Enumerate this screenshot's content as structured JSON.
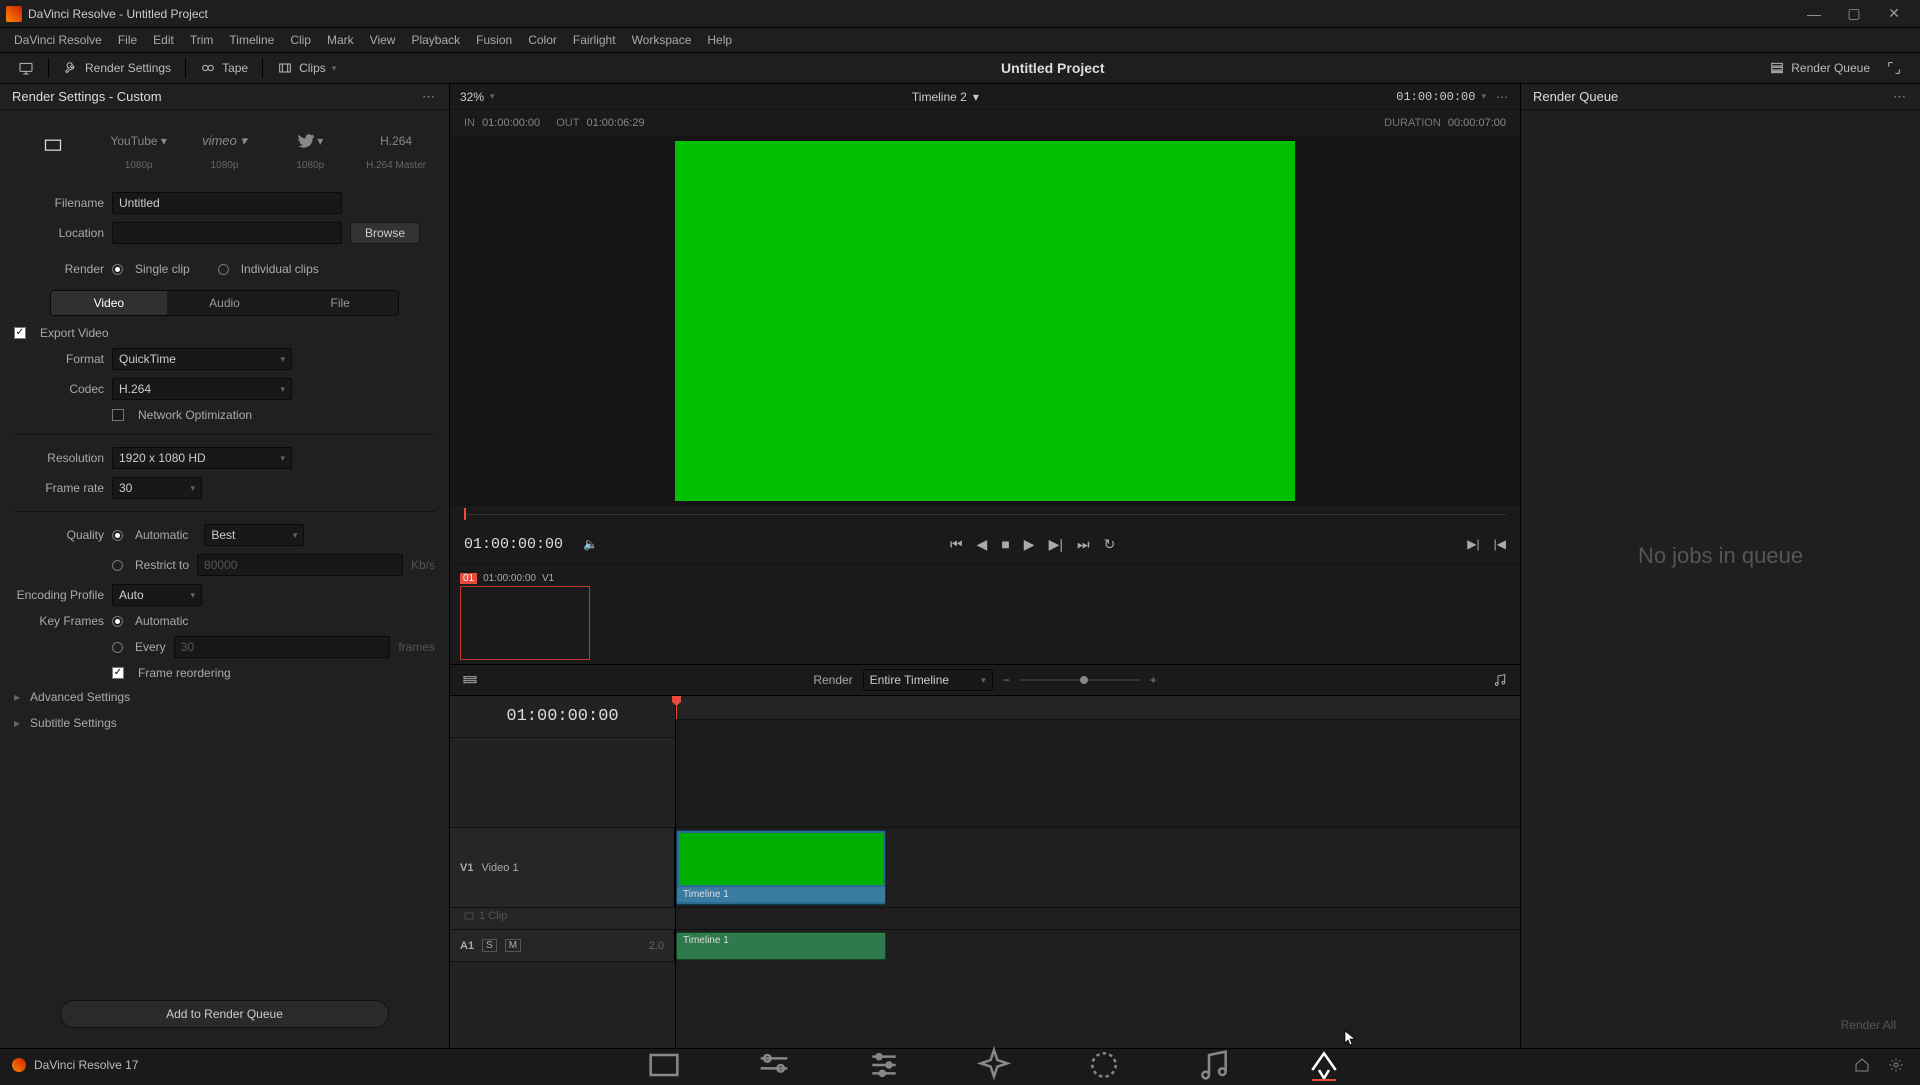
{
  "window": {
    "title": "DaVinci Resolve - Untitled Project"
  },
  "menu": [
    "DaVinci Resolve",
    "File",
    "Edit",
    "Trim",
    "Timeline",
    "Clip",
    "Mark",
    "View",
    "Playback",
    "Fusion",
    "Color",
    "Fairlight",
    "Workspace",
    "Help"
  ],
  "toolbar": {
    "render_settings": "Render Settings",
    "tape": "Tape",
    "clips": "Clips",
    "project": "Untitled Project",
    "render_queue": "Render Queue"
  },
  "left": {
    "header": "Render Settings - Custom",
    "presets": [
      {
        "name": "Custom",
        "sub": ""
      },
      {
        "name": "YouTube ▾",
        "sub": "1080p"
      },
      {
        "name": "vimeo ▾",
        "sub": "1080p"
      },
      {
        "name": "Twitter ▾",
        "sub": "1080p"
      },
      {
        "name": "H.264",
        "sub": "H.264 Master"
      }
    ],
    "filename_label": "Filename",
    "filename": "Untitled",
    "location_label": "Location",
    "location": "",
    "browse": "Browse",
    "render_label": "Render",
    "single": "Single clip",
    "individual": "Individual clips",
    "tabs": [
      "Video",
      "Audio",
      "File"
    ],
    "export_video": "Export Video",
    "format_label": "Format",
    "format": "QuickTime",
    "codec_label": "Codec",
    "codec": "H.264",
    "netopt": "Network Optimization",
    "res_label": "Resolution",
    "res": "1920 x 1080 HD",
    "fps_label": "Frame rate",
    "fps": "30",
    "quality_label": "Quality",
    "quality_auto": "Automatic",
    "quality_best": "Best",
    "restrict": "Restrict to",
    "restrict_val": "80000",
    "kbps": "Kb/s",
    "encprof_label": "Encoding Profile",
    "encprof": "Auto",
    "keyframes_label": "Key Frames",
    "kf_auto": "Automatic",
    "kf_every": "Every",
    "kf_val": "30",
    "kf_unit": "frames",
    "frame_reorder": "Frame reordering",
    "advanced": "Advanced Settings",
    "subtitle": "Subtitle Settings",
    "add": "Add to Render Queue"
  },
  "viewer": {
    "zoom": "32%",
    "timeline": "Timeline 2",
    "tc_display": "01:00:00:00",
    "in_label": "IN",
    "in": "01:00:00:00",
    "out_label": "OUT",
    "out": "01:00:06:29",
    "dur_label": "DURATION",
    "dur": "00:00:07:00",
    "transport_tc": "01:00:00:00",
    "thumb_index": "01",
    "thumb_tc": "01:00:00:00",
    "thumb_track": "V1"
  },
  "tlbar": {
    "render_label": "Render",
    "scope": "Entire Timeline"
  },
  "timeline": {
    "tc": "01:00:00:00",
    "v_tag": "V1",
    "v_name": "Video 1",
    "v_clips_meta": "1 Clip",
    "a_tag": "A1",
    "a_val": "2.0",
    "clip_name": "Timeline 1",
    "aclip_name": "Timeline 1"
  },
  "right": {
    "header": "Render Queue",
    "empty": "No jobs in queue",
    "renderall": "Render All"
  },
  "footer": {
    "brand": "DaVinci Resolve 17"
  }
}
